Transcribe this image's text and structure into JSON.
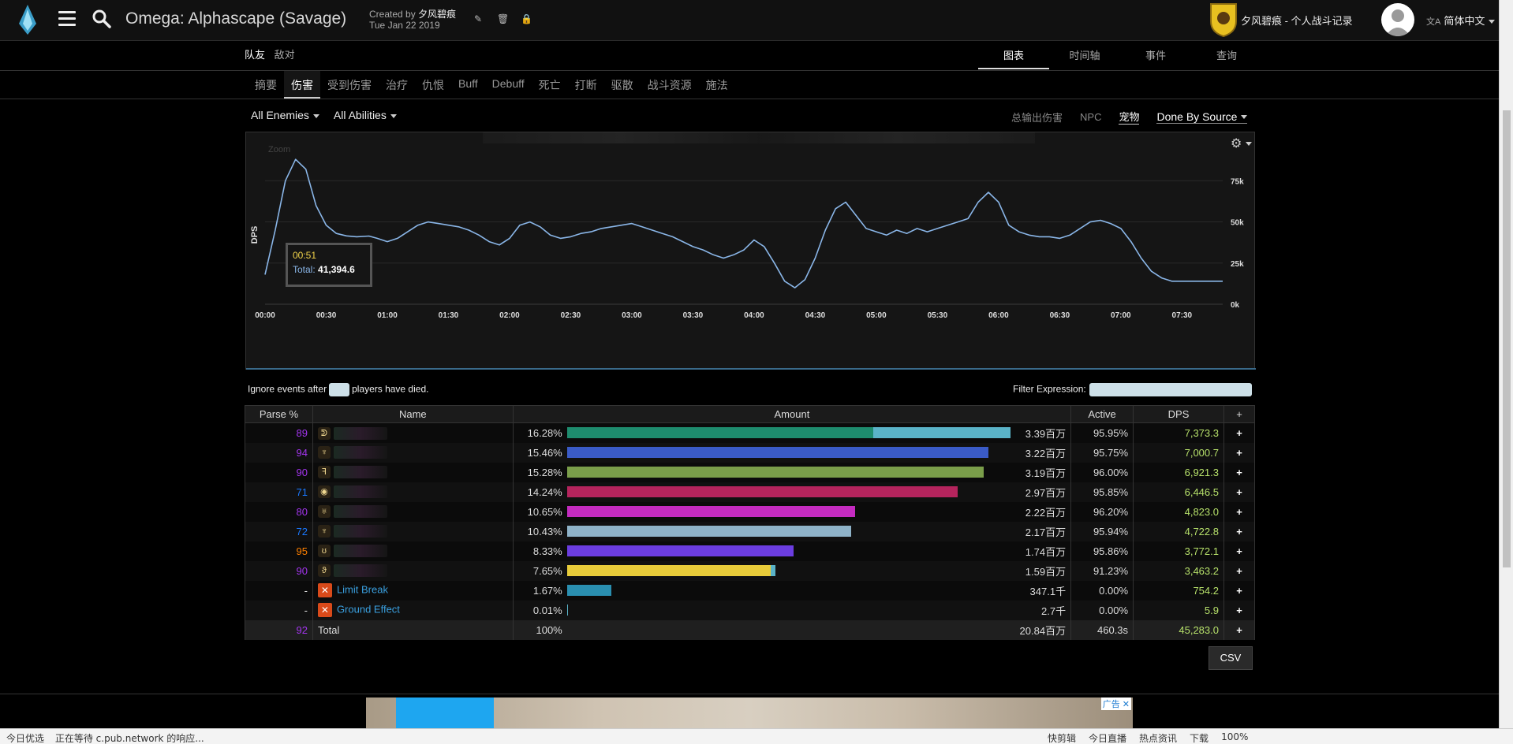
{
  "header": {
    "title": "Omega: Alphascape (Savage)",
    "created_prefix": "Created by",
    "created_by": "夕风碧痕",
    "date": "Tue Jan 22 2019",
    "guild": "夕风碧痕 - 个人战斗记录",
    "language": "简体中文",
    "lang_icon": "文A"
  },
  "friend_enemy": [
    "队友",
    "敌对"
  ],
  "view_tabs": [
    "图表",
    "时间轴",
    "事件",
    "查询"
  ],
  "sub_tabs": [
    "摘要",
    "伤害",
    "受到伤害",
    "治疗",
    "仇恨",
    "Buff",
    "Debuff",
    "死亡",
    "打断",
    "驱散",
    "战斗资源",
    "施法"
  ],
  "filters": {
    "enemies": "All Enemies",
    "abilities": "All Abilities",
    "right": [
      "总输出伤害",
      "NPC",
      "宠物"
    ],
    "done_by": "Done By Source"
  },
  "chart": {
    "zoom": "Zoom",
    "ylabel": "DPS",
    "tooltip_time": "00:51",
    "tooltip_label": "Total:",
    "tooltip_value": "41,394.6"
  },
  "chart_data": {
    "type": "line",
    "ylabel": "DPS",
    "xlim": [
      0,
      470
    ],
    "ylim": [
      0,
      90000
    ],
    "x_ticks": [
      "00:00",
      "00:30",
      "01:00",
      "01:30",
      "02:00",
      "02:30",
      "03:00",
      "03:30",
      "04:00",
      "04:30",
      "05:00",
      "05:30",
      "06:00",
      "06:30",
      "07:00",
      "07:30"
    ],
    "y_ticks": [
      "0k",
      "25k",
      "50k",
      "75k"
    ],
    "series": [
      {
        "x": [
          0,
          5,
          10,
          15,
          20,
          25,
          30,
          35,
          40,
          45,
          51,
          55,
          60,
          65,
          70,
          75,
          80,
          85,
          90,
          95,
          100,
          105,
          110,
          115,
          120,
          125,
          130,
          135,
          140,
          145,
          150,
          155,
          160,
          165,
          170,
          175,
          180,
          185,
          190,
          195,
          200,
          205,
          210,
          215,
          220,
          225,
          230,
          235,
          240,
          245,
          250,
          255,
          260,
          265,
          270,
          275,
          280,
          285,
          290,
          295,
          300,
          305,
          310,
          315,
          320,
          325,
          330,
          335,
          340,
          345,
          350,
          355,
          360,
          365,
          370,
          375,
          380,
          385,
          390,
          395,
          400,
          405,
          410,
          415,
          420,
          425,
          430,
          435,
          440,
          445,
          450,
          455,
          460,
          465,
          470
        ],
        "y": [
          18000,
          45000,
          75000,
          88000,
          82000,
          60000,
          48000,
          43000,
          41500,
          41000,
          41395,
          40000,
          38000,
          40000,
          44000,
          48000,
          50000,
          49000,
          48000,
          47000,
          45000,
          42000,
          38000,
          36000,
          40000,
          48000,
          50000,
          47000,
          42000,
          40000,
          41000,
          43000,
          44000,
          46000,
          47000,
          48000,
          49000,
          47000,
          45000,
          43000,
          41000,
          38000,
          35000,
          33000,
          30000,
          28000,
          30000,
          33000,
          39000,
          35000,
          25000,
          14000,
          10000,
          15000,
          28000,
          45000,
          58000,
          62000,
          54000,
          46000,
          44000,
          42000,
          45000,
          43000,
          46000,
          44000,
          46000,
          48000,
          50000,
          52000,
          62000,
          68000,
          62000,
          48000,
          44000,
          42000,
          41000,
          41000,
          40000,
          42000,
          46000,
          50000,
          51000,
          49000,
          46000,
          38000,
          28000,
          20000,
          16000,
          14000,
          14000,
          14000,
          14000,
          14000,
          14000
        ]
      }
    ]
  },
  "ignore": {
    "prefix": "Ignore events after",
    "suffix": "players have died."
  },
  "filter_expression": "Filter Expression:",
  "table": {
    "headers": [
      "Parse %",
      "Name",
      "Amount",
      "Active",
      "DPS",
      "+"
    ],
    "rows": [
      {
        "parse": "89",
        "parse_color": "#a335ee",
        "icon": "ᕲ",
        "name": "",
        "pct": "16.28%",
        "bar_pct": 69,
        "bar_color": "#1e8c6e",
        "bar2_pct": 31,
        "bar2_color": "#5ab3c8",
        "amount": "3.39百万",
        "active": "95.95%",
        "dps": "7,373.3"
      },
      {
        "parse": "94",
        "parse_color": "#a335ee",
        "icon": "♆",
        "name": "",
        "pct": "15.46%",
        "bar_pct": 95,
        "bar_color": "#3a5bc7",
        "bar2_pct": 0,
        "bar2_color": "#3a5bc7",
        "amount": "3.22百万",
        "active": "95.75%",
        "dps": "7,000.7"
      },
      {
        "parse": "90",
        "parse_color": "#a335ee",
        "icon": "ꟻ",
        "name": "",
        "pct": "15.28%",
        "bar_pct": 94,
        "bar_color": "#7a9e4a",
        "bar2_pct": 0,
        "bar2_color": "#7a9e4a",
        "amount": "3.19百万",
        "active": "96.00%",
        "dps": "6,921.3"
      },
      {
        "parse": "71",
        "parse_color": "#1a78ff",
        "icon": "◉",
        "name": "",
        "pct": "14.24%",
        "bar_pct": 88,
        "bar_color": "#b5245d",
        "bar2_pct": 0,
        "bar2_color": "#b5245d",
        "amount": "2.97百万",
        "active": "95.85%",
        "dps": "6,446.5"
      },
      {
        "parse": "80",
        "parse_color": "#a335ee",
        "icon": "♅",
        "name": "",
        "pct": "10.65%",
        "bar_pct": 65,
        "bar_color": "#c42bc0",
        "bar2_pct": 0,
        "bar2_color": "#c42bc0",
        "amount": "2.22百万",
        "active": "96.20%",
        "dps": "4,823.0"
      },
      {
        "parse": "72",
        "parse_color": "#1a78ff",
        "icon": "♆",
        "name": "",
        "pct": "10.43%",
        "bar_pct": 64,
        "bar_color": "#8fb3c9",
        "bar2_pct": 0,
        "bar2_color": "#8fb3c9",
        "amount": "2.17百万",
        "active": "95.94%",
        "dps": "4,722.8"
      },
      {
        "parse": "95",
        "parse_color": "#ff8000",
        "icon": "ʊ",
        "name": "",
        "pct": "8.33%",
        "bar_pct": 51,
        "bar_color": "#6b3de0",
        "bar2_pct": 0,
        "bar2_color": "#6b3de0",
        "amount": "1.74百万",
        "active": "95.86%",
        "dps": "3,772.1"
      },
      {
        "parse": "90",
        "parse_color": "#a335ee",
        "icon": "ϑ",
        "name": "",
        "pct": "7.65%",
        "bar_pct": 46,
        "bar_color": "#e8cc3a",
        "bar2_pct": 1,
        "bar2_color": "#5ab3c8",
        "amount": "1.59百万",
        "active": "91.23%",
        "dps": "3,463.2"
      },
      {
        "parse": "-",
        "parse_color": "#dddddd",
        "icon": "✕",
        "name": "Limit Break",
        "pct": "1.67%",
        "bar_pct": 10,
        "bar_color": "#2a8fb0",
        "bar2_pct": 0,
        "bar2_color": "#2a8fb0",
        "amount": "347.1千",
        "active": "0.00%",
        "dps": "754.2"
      },
      {
        "parse": "-",
        "parse_color": "#dddddd",
        "icon": "✕",
        "name": "Ground Effect",
        "pct": "0.01%",
        "bar_pct": 0.2,
        "bar_color": "#5ab3c8",
        "bar2_pct": 0,
        "bar2_color": "#5ab3c8",
        "amount": "2.7千",
        "active": "0.00%",
        "dps": "5.9"
      }
    ],
    "total": {
      "parse": "92",
      "parse_color": "#a335ee",
      "name": "Total",
      "pct": "100%",
      "amount": "20.84百万",
      "active": "460.3s",
      "dps": "45,283.0"
    }
  },
  "csv": "CSV",
  "ad": {
    "label": "广告"
  },
  "statusbar": {
    "left": [
      "今日优选",
      "正在等待 c.pub.network 的响应..."
    ],
    "right": [
      "快剪辑",
      "今日直播",
      "热点资讯",
      "下载",
      "100%"
    ]
  }
}
